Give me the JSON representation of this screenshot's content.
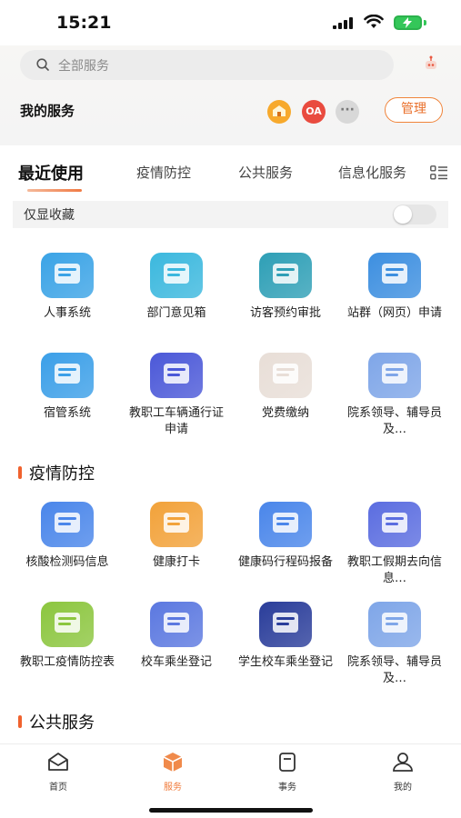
{
  "status_bar": {
    "time": "15:21"
  },
  "search": {
    "placeholder": "全部服务"
  },
  "my_services": {
    "label": "我的服务",
    "quick_icons": [
      {
        "name": "quick-app-icon",
        "text": "🏠"
      },
      {
        "name": "oa-icon",
        "text": "OA"
      },
      {
        "name": "more-icon",
        "text": "···"
      }
    ],
    "manage_label": "管理"
  },
  "tabs": [
    "最近使用",
    "疫情防控",
    "公共服务",
    "信息化服务"
  ],
  "favorites": {
    "label": "仅显收藏",
    "toggle_on": false
  },
  "recent_apps": [
    {
      "label": "人事系统",
      "icon": "hr-system-icon",
      "color": "#3aa3e6"
    },
    {
      "label": "部门意见箱",
      "icon": "suggestion-box-icon",
      "color": "#3bb8de"
    },
    {
      "label": "访客预约审批",
      "icon": "visitor-approval-icon",
      "color": "#2e9fb6"
    },
    {
      "label": "站群（网页）申请",
      "icon": "site-group-icon",
      "color": "#3d8fe0"
    },
    {
      "label": "宿管系统",
      "icon": "dorm-system-icon",
      "color": "#3b9fe8"
    },
    {
      "label": "教职工车辆通行证申请",
      "icon": "vehicle-pass-icon",
      "color": "#4b58d8"
    },
    {
      "label": "党费缴纳",
      "icon": "party-fee-icon",
      "color": "#e8ded7"
    },
    {
      "label": "院系领导、辅导员及…",
      "icon": "department-leaders-icon",
      "color": "#7fa6e8"
    }
  ],
  "sections": [
    {
      "title": "疫情防控",
      "apps": [
        {
          "label": "核酸检测码信息",
          "icon": "nucleic-test-icon",
          "color": "#4a86ea"
        },
        {
          "label": "健康打卡",
          "icon": "health-checkin-icon",
          "color": "#f2a23a"
        },
        {
          "label": "健康码行程码报备",
          "icon": "health-code-icon",
          "color": "#4a86ea"
        },
        {
          "label": "教职工假期去向信息…",
          "icon": "staff-holiday-icon",
          "color": "#5b6de0"
        },
        {
          "label": "教职工疫情防控表",
          "icon": "staff-epidemic-form-icon",
          "color": "#8cc63f"
        },
        {
          "label": "校车乘坐登记",
          "icon": "school-bus-register-icon",
          "color": "#5b78e0"
        },
        {
          "label": "学生校车乘坐登记",
          "icon": "student-bus-register-icon",
          "color": "#2a3d9a"
        },
        {
          "label": "院系领导、辅导员及…",
          "icon": "department-leaders-icon",
          "color": "#7fa6e8"
        }
      ]
    },
    {
      "title": "公共服务",
      "apps": []
    }
  ],
  "bottom_nav": [
    {
      "label": "首页",
      "icon": "home-icon",
      "active": false
    },
    {
      "label": "服务",
      "icon": "service-box-icon",
      "active": true
    },
    {
      "label": "事务",
      "icon": "affairs-icon",
      "active": false
    },
    {
      "label": "我的",
      "icon": "profile-icon",
      "active": false
    }
  ],
  "colors": {
    "accent": "#f07a3a",
    "toggle_off": "#e6e6e6"
  }
}
